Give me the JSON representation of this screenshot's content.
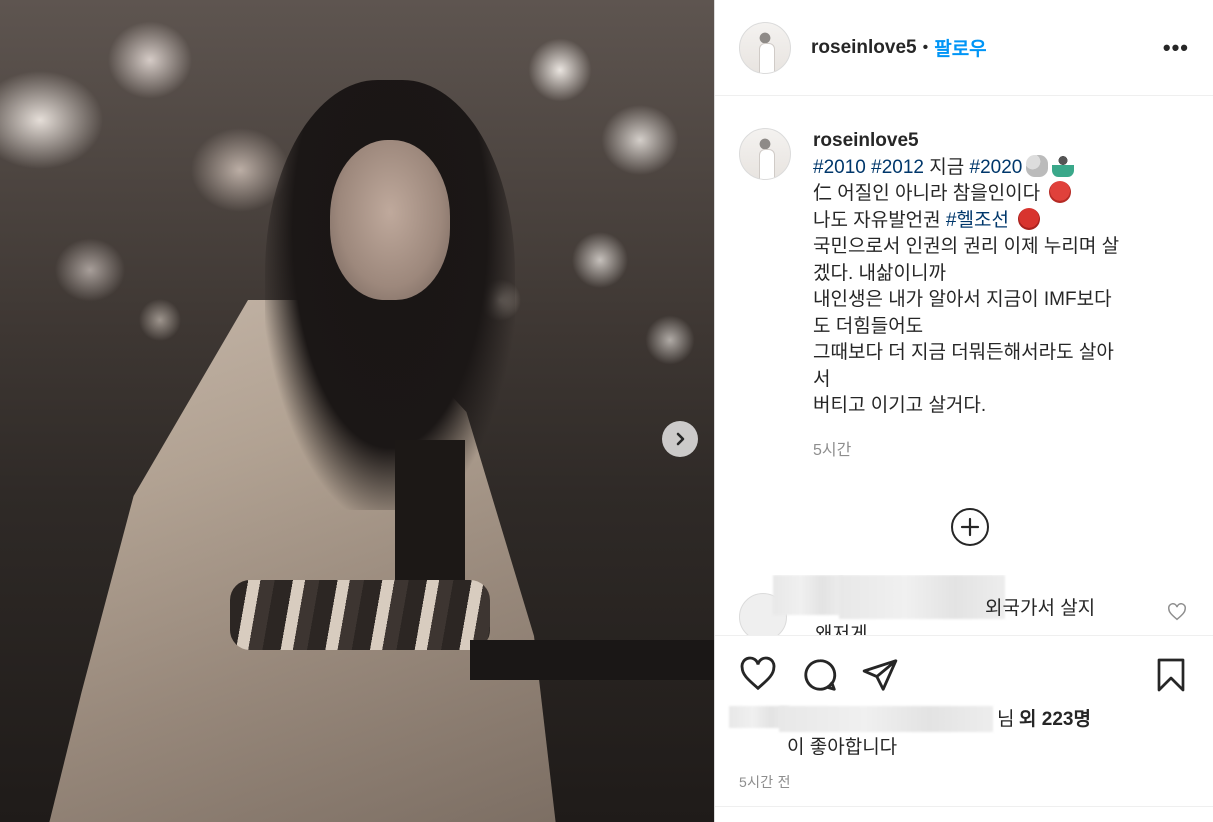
{
  "post": {
    "username": "roseinlove5",
    "follow_label": "팔로우",
    "dot": "•",
    "more": "•••"
  },
  "caption": {
    "username": "roseinlove5",
    "tag_2010": "#2010",
    "tag_2012": "#2012",
    "now": "지금",
    "tag_2020": "#2020",
    "line2": "仁 어질인 아니라 참을인이다",
    "line3_prefix": "나도 자유발언권",
    "tag_hell": "#헬조선",
    "line4": "국민으로서 인권의 권리 이제 누리며 살",
    "line5": "겠다. 내삶이니까",
    "line6": "내인생은 내가 알아서 지금이 IMF보다",
    "line7": "도 더힘들어도",
    "line8": "그때보다 더 지금 더뭐든해서라도 살아",
    "line9": "서",
    "line10": "버티고 이기고 살거다.",
    "time": "5시간"
  },
  "comment": {
    "text": "외국가서 살지",
    "text2": "왜저게"
  },
  "likes": {
    "nim": "님",
    "count": "외 223명",
    "suffix": "이 좋아합니다"
  },
  "post_time": "5시간 전",
  "icons": [
    "chevron-right-icon",
    "more-icon",
    "add-circle-icon",
    "heart-icon",
    "comment-icon",
    "share-icon",
    "bookmark-icon"
  ]
}
